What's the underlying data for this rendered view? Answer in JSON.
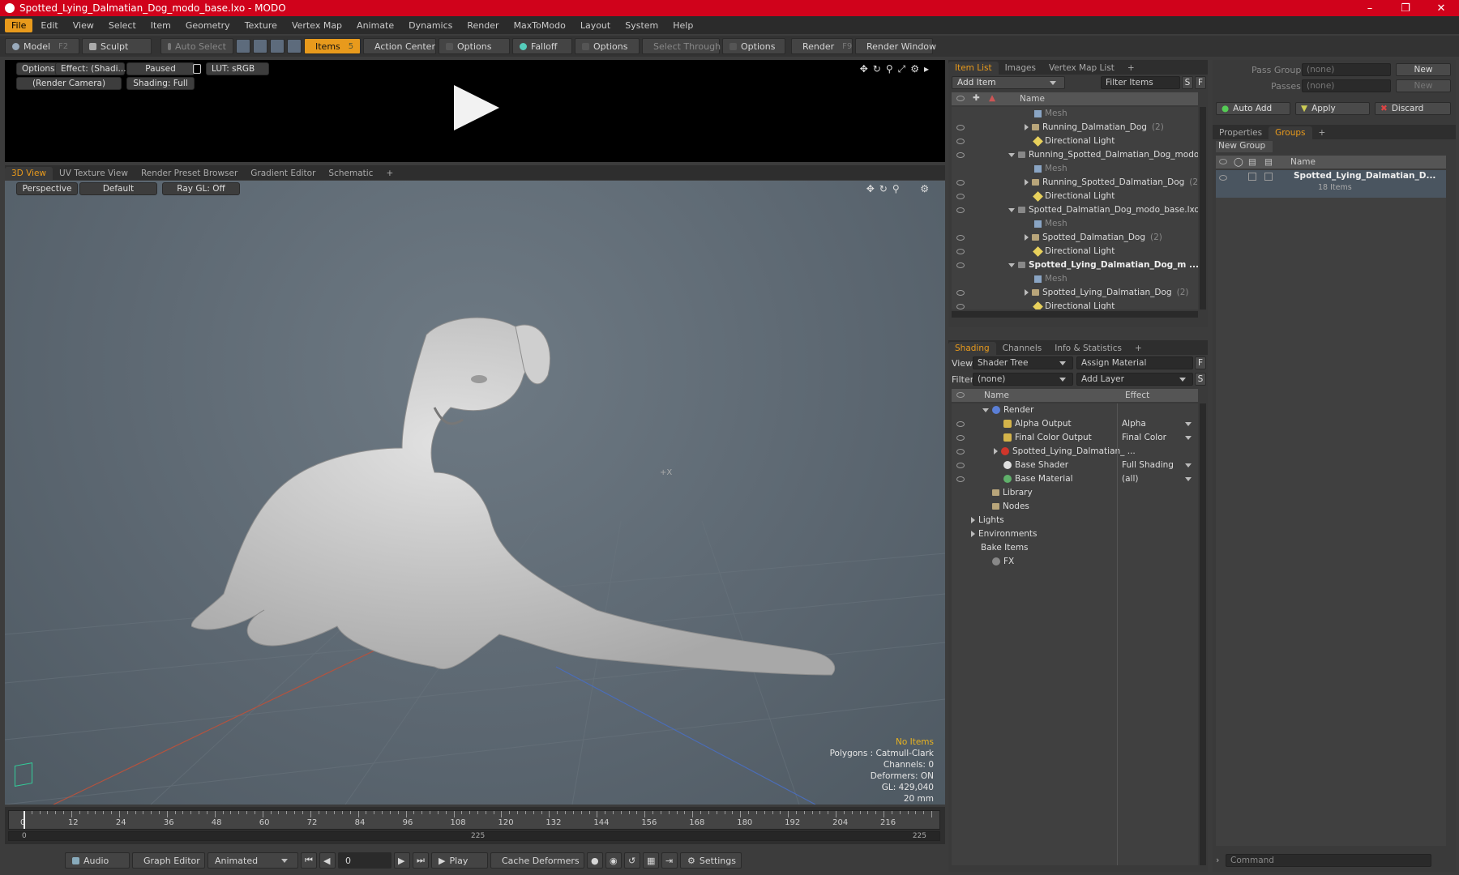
{
  "window": {
    "title": "Spotted_Lying_Dalmatian_Dog_modo_base.lxo - MODO"
  },
  "menu": [
    "File",
    "Edit",
    "View",
    "Select",
    "Item",
    "Geometry",
    "Texture",
    "Vertex Map",
    "Animate",
    "Dynamics",
    "Render",
    "MaxToModo",
    "Layout",
    "System",
    "Help"
  ],
  "toolbar": {
    "model": "Model",
    "model_key": "F2",
    "sculpt": "Sculpt",
    "auto_select": "Auto Select",
    "items": "Items",
    "items_key": "5",
    "action_center": "Action Center",
    "options1": "Options",
    "falloff": "Falloff",
    "options2": "Options",
    "select_through": "Select Through",
    "options3": "Options",
    "render": "Render",
    "render_key": "F9",
    "render_window": "Render Window"
  },
  "render_view": {
    "options": "Options",
    "effect": "Effect: (Shadi...",
    "paused": "Paused",
    "lut": "LUT: sRGB",
    "camera": "(Render Camera)",
    "shading": "Shading: Full"
  },
  "view_tabs": [
    "3D View",
    "UV Texture View",
    "Render Preset Browser",
    "Gradient Editor",
    "Schematic"
  ],
  "view3d": {
    "perspective": "Perspective",
    "default": "Default",
    "raygl": "Ray GL: Off",
    "center_mark": "+X"
  },
  "stats": {
    "no_items": "No Items",
    "polygons": "Polygons : Catmull-Clark",
    "channels": "Channels: 0",
    "deformers": "Deformers: ON",
    "gl": "GL: 429,040",
    "units": "20 mm"
  },
  "timeline": {
    "ticks": [
      "0",
      "12",
      "24",
      "36",
      "48",
      "60",
      "72",
      "84",
      "96",
      "108",
      "120",
      "132",
      "144",
      "156",
      "168",
      "180",
      "192",
      "204",
      "216"
    ],
    "start": "0",
    "mid": "225",
    "end": "225"
  },
  "bottombar": {
    "audio": "Audio",
    "graph_editor": "Graph Editor",
    "animated": "Animated",
    "frame": "0",
    "play": "Play",
    "cache_deformers": "Cache Deformers",
    "settings": "Settings"
  },
  "itemlist": {
    "tabs": [
      "Item List",
      "Images",
      "Vertex Map List"
    ],
    "add_item": "Add Item",
    "filter_items": "Filter Items",
    "s": "S",
    "f": "F",
    "col_name": "Name",
    "rows": [
      {
        "label": "Mesh",
        "type": "mesh",
        "indent": 3,
        "dim": true
      },
      {
        "label": "Running_Dalmatian_Dog",
        "count": "(2)",
        "type": "group",
        "indent": 3,
        "arrow": "right"
      },
      {
        "label": "Directional Light",
        "type": "light",
        "indent": 3
      },
      {
        "label": "Running_Spotted_Dalmatian_Dog_modo ...",
        "type": "scene",
        "indent": 2,
        "arrow": "down"
      },
      {
        "label": "Mesh",
        "type": "mesh",
        "indent": 3,
        "dim": true
      },
      {
        "label": "Running_Spotted_Dalmatian_Dog",
        "count": "(2)",
        "type": "group",
        "indent": 3,
        "arrow": "right"
      },
      {
        "label": "Directional Light",
        "type": "light",
        "indent": 3
      },
      {
        "label": "Spotted_Dalmatian_Dog_modo_base.lxo",
        "type": "scene",
        "indent": 2,
        "arrow": "down"
      },
      {
        "label": "Mesh",
        "type": "mesh",
        "indent": 3,
        "dim": true
      },
      {
        "label": "Spotted_Dalmatian_Dog",
        "count": "(2)",
        "type": "group",
        "indent": 3,
        "arrow": "right"
      },
      {
        "label": "Directional Light",
        "type": "light",
        "indent": 3
      },
      {
        "label": "Spotted_Lying_Dalmatian_Dog_m ...",
        "type": "scene",
        "indent": 2,
        "arrow": "down",
        "bold": true
      },
      {
        "label": "Mesh",
        "type": "mesh",
        "indent": 3,
        "dim": true
      },
      {
        "label": "Spotted_Lying_Dalmatian_Dog",
        "count": "(2)",
        "type": "group",
        "indent": 3,
        "arrow": "right"
      },
      {
        "label": "Directional Light",
        "type": "light",
        "indent": 3
      }
    ]
  },
  "shading": {
    "tabs": [
      "Shading",
      "Channels",
      "Info & Statistics"
    ],
    "view_label": "View",
    "view_value": "Shader Tree",
    "assign_material": "Assign Material",
    "f": "F",
    "filter_label": "Filter",
    "filter_value": "(none)",
    "add_layer": "Add Layer",
    "s": "S",
    "col_name": "Name",
    "col_effect": "Effect",
    "rows": [
      {
        "label": "Render",
        "effect": "",
        "icon": "render",
        "indent": 1,
        "arrow": "down"
      },
      {
        "label": "Alpha Output",
        "effect": "Alpha",
        "icon": "output",
        "indent": 2
      },
      {
        "label": "Final Color Output",
        "effect": "Final Color",
        "icon": "output",
        "indent": 2
      },
      {
        "label": "Spotted_Lying_Dalmatian_ ...",
        "effect": "",
        "icon": "material",
        "indent": 2,
        "arrow": "right"
      },
      {
        "label": "Base Shader",
        "effect": "Full Shading",
        "icon": "shader",
        "indent": 2
      },
      {
        "label": "Base Material",
        "effect": "(all)",
        "icon": "basemat",
        "indent": 2
      },
      {
        "label": "Library",
        "effect": "",
        "icon": "folder",
        "indent": 1
      },
      {
        "label": "Nodes",
        "effect": "",
        "icon": "folder",
        "indent": 1
      },
      {
        "label": "Lights",
        "effect": "",
        "icon": "none",
        "indent": 0,
        "arrow": "right"
      },
      {
        "label": "Environments",
        "effect": "",
        "icon": "none",
        "indent": 0,
        "arrow": "right"
      },
      {
        "label": "Bake Items",
        "effect": "",
        "icon": "none",
        "indent": 0
      },
      {
        "label": "FX",
        "effect": "",
        "icon": "fx",
        "indent": 1
      }
    ]
  },
  "props": {
    "pass_groups": "Pass Groups",
    "passes": "Passes",
    "none": "(none)",
    "new": "New",
    "auto_add": "Auto Add",
    "apply": "Apply",
    "discard": "Discard",
    "tabs": [
      "Properties",
      "Groups"
    ],
    "new_group": "New Group",
    "col_name": "Name",
    "group_name": "Spotted_Lying_Dalmatian_D...",
    "group_count": "18 Items",
    "command": "Command"
  },
  "colors": {
    "accent": "#e89a1c",
    "titlebar": "#d0021b"
  }
}
